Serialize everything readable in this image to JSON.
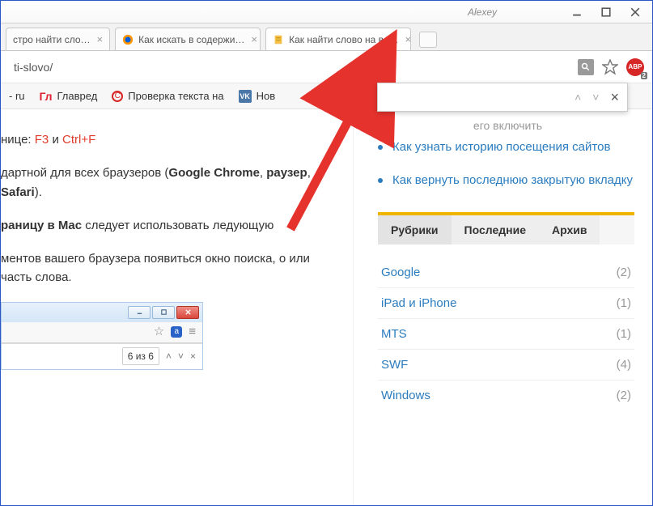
{
  "window": {
    "user": "Alexey"
  },
  "tabs": [
    {
      "title": "стро найти сло…"
    },
    {
      "title": "Как искать в содержи…"
    },
    {
      "title": "Как найти слово на ве…"
    }
  ],
  "address": {
    "url": "ti-slovo/",
    "abp_label": "ABP",
    "abp_count": "2"
  },
  "bookmarks": [
    {
      "label": "- ru"
    },
    {
      "label": "Главред"
    },
    {
      "label": "Проверка текста на"
    },
    {
      "label": "Нов"
    }
  ],
  "findbar": {
    "placeholder": ""
  },
  "article": {
    "line1_prefix": "нице: ",
    "kw_f3": "F3",
    "kw_and": " и ",
    "kw_ctrlf": "Ctrl+F",
    "line2_a": "дартной для всех браузеров (",
    "kw_chrome": "Google Chrome",
    "line2_b": ", ",
    "kw_browser": "раузер",
    "line2_c": ", ",
    "kw_safari": "Safari",
    "line2_d": ").",
    "line3_a": "раницу в Mac",
    "line3_b": " следует использовать  ледующую",
    "line4": "ментов вашего браузера появиться окно поиска, о или часть слова."
  },
  "mini": {
    "count": "6 из 6",
    "a_letter": "a"
  },
  "sidebar": {
    "top_cut": "его включить",
    "links": [
      "Как узнать историю посещения сайтов",
      "Как вернуть последнюю закрытую вкладку"
    ],
    "tabs": [
      "Рубрики",
      "Последние",
      "Архив"
    ],
    "cats": [
      {
        "name": "Google",
        "count": "(2)"
      },
      {
        "name": "iPad и iPhone",
        "count": "(1)"
      },
      {
        "name": "MTS",
        "count": "(1)"
      },
      {
        "name": "SWF",
        "count": "(4)"
      },
      {
        "name": "Windows",
        "count": "(2)"
      }
    ]
  }
}
